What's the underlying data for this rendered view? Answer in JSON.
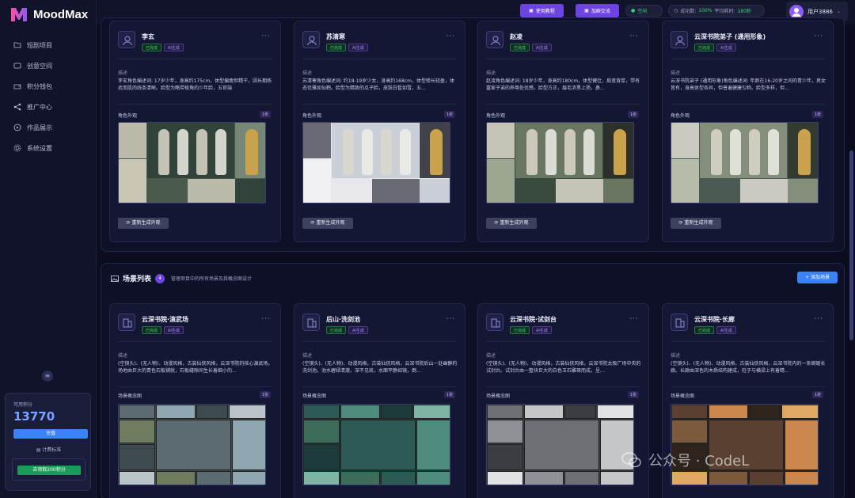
{
  "app": {
    "name": "MoodMax"
  },
  "sidebar": {
    "items": [
      {
        "label": "短剧项目",
        "icon": "folder-icon"
      },
      {
        "label": "创意空间",
        "icon": "sparkle-icon"
      },
      {
        "label": "积分钱包",
        "icon": "wallet-icon"
      },
      {
        "label": "推广中心",
        "icon": "share-icon"
      },
      {
        "label": "作品展示",
        "icon": "play-icon"
      },
      {
        "label": "系统设置",
        "icon": "gear-icon"
      }
    ],
    "collapse_icon": "menu-icon",
    "credits": {
      "label": "可用积分",
      "value": "13770",
      "recharge_label": "充值",
      "rule_label": "计费标准",
      "claim_label": "去领取200积分"
    }
  },
  "topbar": {
    "tutorial_label": "使用教程",
    "group_label": "加群交流",
    "status_label": "空闲",
    "success_rate_label": "成功数:",
    "success_rate_value": "100%",
    "avg_time_label": "平均耗时:",
    "avg_time_value": "180秒",
    "user_name": "用户3886"
  },
  "characters": [
    {
      "name": "李玄",
      "tag_done": "已完成",
      "tag_ai": "AI生成",
      "desc_label": "描述",
      "desc": "李玄角色编述词: 17岁少年，身高约175cm，体型偏瘦但精干，因长期练武而肌肉线条清晰。脸型为略带棱角的少年脸，五官端",
      "section_label": "角色外观",
      "count": "1张",
      "regen_label": "重新生成外观"
    },
    {
      "name": "苏清寒",
      "tag_done": "已完成",
      "tag_ai": "AI生成",
      "desc_label": "描述",
      "desc": "苏清寒角色编述词: 约18-19岁少女，身高约168cm，体型修长轻盈，体态优雅如仙鹤。脸型为精致的瓜子脸，皮肤白皙如雪，五...",
      "section_label": "角色外观",
      "count": "1张",
      "regen_label": "重新生成外观"
    },
    {
      "name": "赵凌",
      "tag_done": "已完成",
      "tag_ai": "AI生成",
      "desc_label": "描述",
      "desc": "赵凌角色编述词: 18岁少年，身高约180cm，体型健壮，肩宽背厚，带有富家子弟的养尊处优感。脸型方正，眉毛浓黑上扬，鼻...",
      "section_label": "角色外观",
      "count": "1张",
      "regen_label": "重新生成外观"
    },
    {
      "name": "云深书院弟子 (通用形象)",
      "tag_done": "已完成",
      "tag_ai": "AI生成",
      "desc_label": "描述",
      "desc": "云深书院弟子 (通用形象)角色编述词: 年龄在16-20岁之间的青少年，男女皆有，身高体型各异，但普遍健康匀称。脸型多样，但...",
      "section_label": "角色外观",
      "count": "1张",
      "regen_label": "重新生成外观"
    }
  ],
  "scenes_section": {
    "title": "场景列表",
    "count": "4",
    "subtitle": "管理项目中的所有场景及其概念图设计",
    "add_label": "+ 添加场景"
  },
  "scenes": [
    {
      "name": "云深书院·演武场",
      "tag_done": "已完成",
      "tag_ai": "AI生成",
      "desc_label": "描述",
      "desc": "(空镜头)、(无人物)、动漫风格，古装仙侠风格，云深书院的核心演武场。场地由巨大的青色石板铺就，石板缝隙间生长着细小的...",
      "section_label": "场景概念图",
      "count": "1张"
    },
    {
      "name": "后山·洗剑池",
      "tag_done": "已完成",
      "tag_ai": "AI生成",
      "desc_label": "描述",
      "desc": "(空镜头)、(无人物)、动漫风格，古装仙侠风格，云深书院后山一处幽静的洗剑池。池水碧绿清澈，深不见底，水面平静如镜，倒...",
      "section_label": "场景概念图",
      "count": "1张"
    },
    {
      "name": "云深书院·试剑台",
      "tag_done": "已完成",
      "tag_ai": "AI生成",
      "desc_label": "描述",
      "desc": "(空镜头)、(无人物)、动漫风格，古装仙侠风格，云深书院太极广场中央的试剑台。试剑台由一整块巨大的白色玉石雕琢而成，呈...",
      "section_label": "场景概念图",
      "count": "1张"
    },
    {
      "name": "云深书院·长廊",
      "tag_done": "已完成",
      "tag_ai": "AI生成",
      "desc_label": "描述",
      "desc": "(空镜头)、(无人物)、动漫风格，古装仙侠风格，云深书院内的一条蜿蜒长廊。长廊由深色的木质结构建成，柱子与横梁上有着精...",
      "section_label": "场景概念图",
      "count": "1张"
    }
  ],
  "watermark": {
    "text": "公众号 · CodeL"
  },
  "colors": {
    "accent": "#6d44e0",
    "primary": "#3b82f6",
    "success": "#3ad17d",
    "bg": "#0b0d1f"
  }
}
